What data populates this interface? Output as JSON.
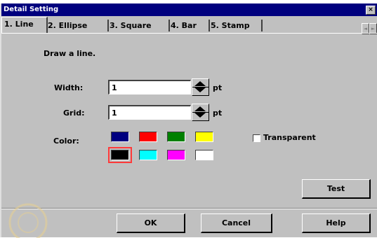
{
  "dialog": {
    "title": "Detail Setting",
    "close": "×"
  },
  "tabs": [
    {
      "label": "1. Line",
      "active": true
    },
    {
      "label": "2. Ellipse",
      "active": false
    },
    {
      "label": "3. Square",
      "active": false
    },
    {
      "label": "4. Bar",
      "active": false
    },
    {
      "label": "5. Stamp",
      "active": false
    }
  ],
  "tab_scroll": {
    "left": "◄",
    "right": "►"
  },
  "instruction": "Draw a line.",
  "width": {
    "label": "Width:",
    "value": "1",
    "unit": "pt"
  },
  "grid": {
    "label": "Grid:",
    "value": "1",
    "unit": "pt"
  },
  "color": {
    "label": "Color:",
    "swatches": [
      "#000080",
      "#ff0000",
      "#008000",
      "#ffff00",
      "#000000",
      "#00ffff",
      "#ff00ff",
      "#ffffff"
    ],
    "selected": "#000000"
  },
  "transparent": {
    "label": "Transparent",
    "checked": false
  },
  "buttons": {
    "test": "Test",
    "ok": "OK",
    "cancel": "Cancel",
    "help": "Help"
  }
}
